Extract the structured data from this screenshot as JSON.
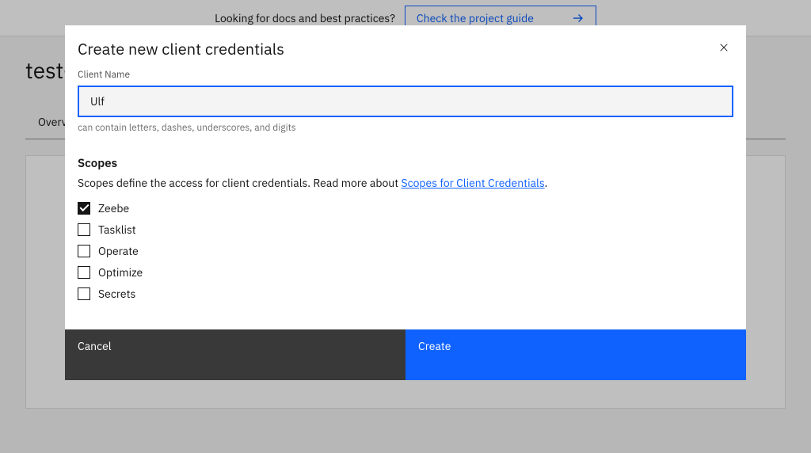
{
  "banner": {
    "text": "Looking for docs and best practices?",
    "link_label": "Check the project guide"
  },
  "page": {
    "title": "test-c",
    "tabs": [
      "Overv"
    ]
  },
  "modal": {
    "title": "Create new client credentials",
    "client_name": {
      "label": "Client Name",
      "value": "Ulf",
      "helper": "can contain letters, dashes, underscores, and digits"
    },
    "scopes": {
      "heading": "Scopes",
      "description_prefix": "Scopes define the access for client credentials. Read more about ",
      "description_link": "Scopes for Client Credentials",
      "description_suffix": ".",
      "items": [
        {
          "label": "Zeebe",
          "checked": true
        },
        {
          "label": "Tasklist",
          "checked": false
        },
        {
          "label": "Operate",
          "checked": false
        },
        {
          "label": "Optimize",
          "checked": false
        },
        {
          "label": "Secrets",
          "checked": false
        }
      ]
    },
    "buttons": {
      "cancel": "Cancel",
      "create": "Create"
    }
  }
}
